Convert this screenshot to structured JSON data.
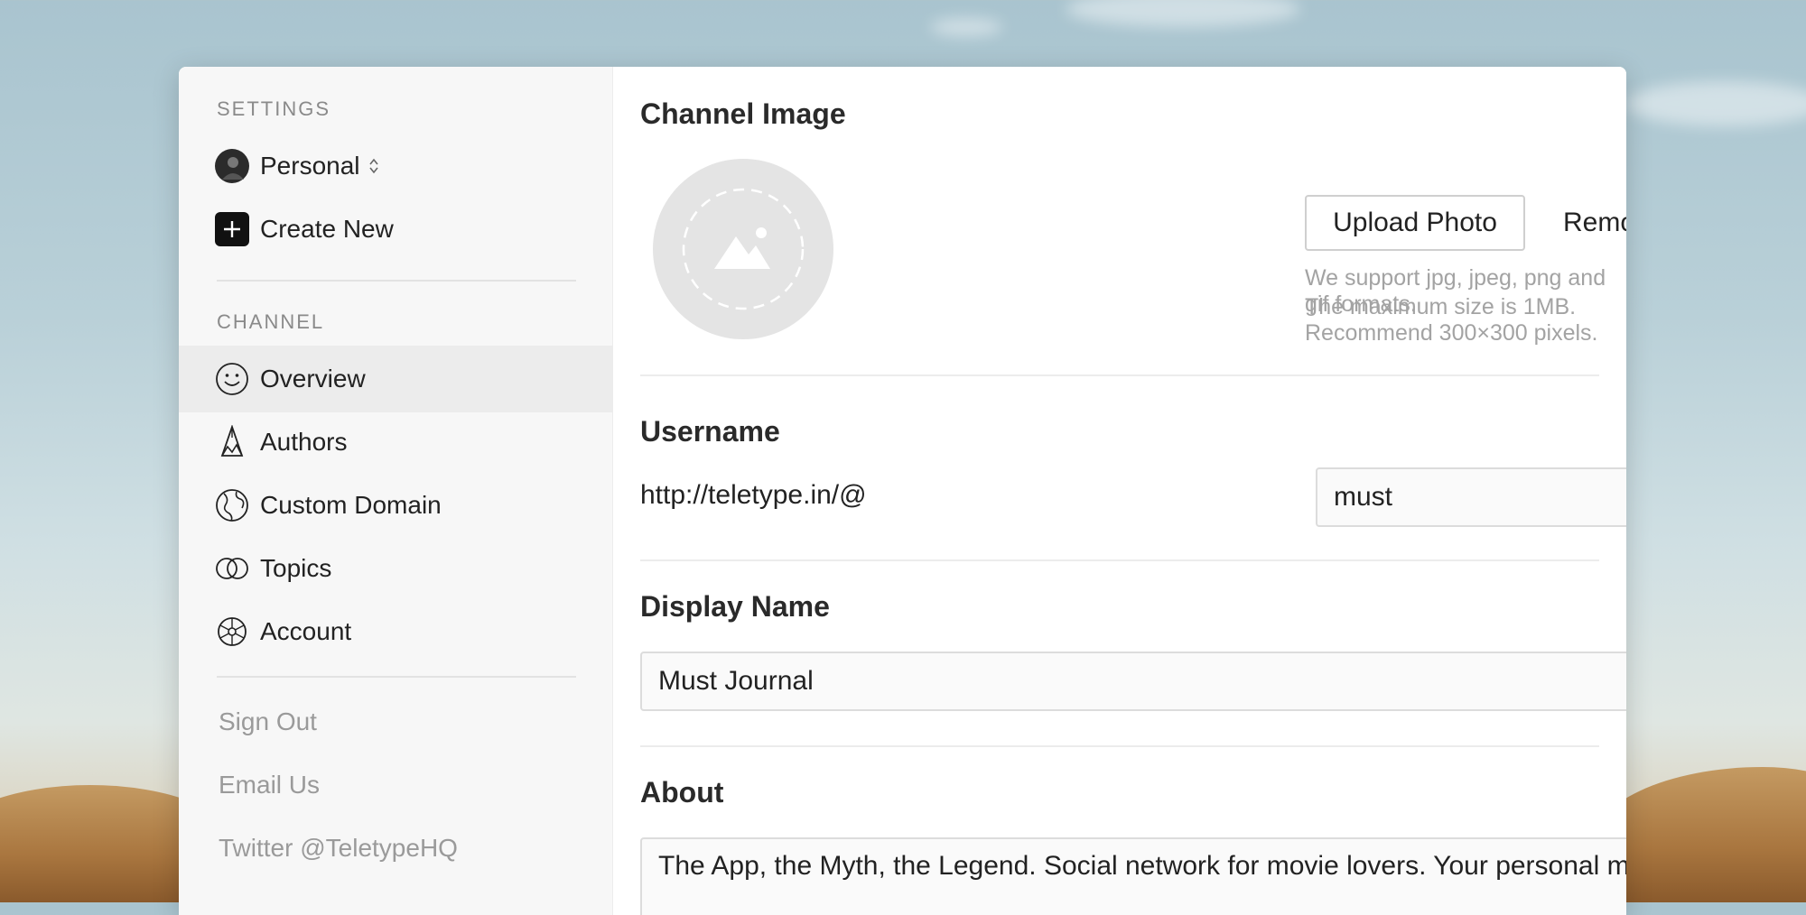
{
  "sidebar": {
    "settings_label": "SETTINGS",
    "account_switcher": {
      "label": "Personal",
      "icon": "chevron-updown-icon"
    },
    "create_new": {
      "label": "Create New",
      "icon": "plus-icon"
    },
    "channel_label": "CHANNEL",
    "items": [
      {
        "label": "Overview",
        "icon": "smiley-icon",
        "active": true
      },
      {
        "label": "Authors",
        "icon": "pen-nib-icon",
        "active": false
      },
      {
        "label": "Custom Domain",
        "icon": "globe-icon",
        "active": false
      },
      {
        "label": "Topics",
        "icon": "overlapping-circles-icon",
        "active": false
      },
      {
        "label": "Account",
        "icon": "gear-icon",
        "active": false
      }
    ],
    "links": [
      {
        "label": "Sign Out"
      },
      {
        "label": "Email Us"
      },
      {
        "label": "Twitter @TeletypeHQ"
      }
    ]
  },
  "main": {
    "channel_image": {
      "title": "Channel Image",
      "upload_label": "Upload Photo",
      "remove_label": "Remove",
      "hint_line1": "We support jpg, jpeg, png and gif formats.",
      "hint_line2": "The maximum size is 1MB. Recommend 300×300 pixels."
    },
    "username": {
      "title": "Username",
      "prefix": "http://teletype.in/@",
      "value": "must"
    },
    "display_name": {
      "title": "Display Name",
      "value": "Must Journal"
    },
    "about": {
      "title": "About",
      "value": "The App, the Myth, the Legend. Social network for movie lovers. Your personal movie assistant. Ask me anything."
    }
  },
  "colors": {
    "active_row": "#ececec",
    "sidebar_bg": "#f7f7f7",
    "muted_text": "#9a9a9a"
  }
}
